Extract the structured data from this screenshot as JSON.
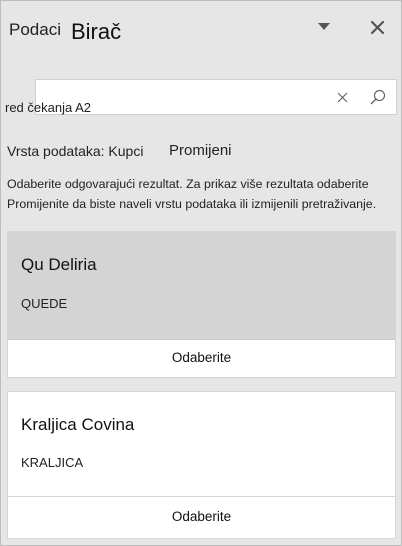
{
  "header": {
    "title_part1": "Podaci",
    "title_part2": "Birač",
    "menu_icon": "chevron-down-icon",
    "close_icon": "close-icon"
  },
  "search": {
    "value": "red čekanja A2",
    "clear_icon": "clear-icon",
    "search_icon": "search-icon"
  },
  "data_type": {
    "label": "Vrsta podataka: Kupci",
    "change_link": "Promijeni"
  },
  "instructions": {
    "line1": "Odaberite odgovarajući rezultat. Za prikaz više rezultata odaberite",
    "line2": "Promijenite da biste naveli vrstu podataka ili izmijenili pretraživanje."
  },
  "results": [
    {
      "name": "Qu Deliria",
      "code": "QUEDE",
      "select_label": "Odaberite",
      "highlighted": true
    },
    {
      "name": "Kraljica Covina",
      "code": "KRALJICA",
      "select_label": "Odaberite",
      "highlighted": false
    }
  ],
  "colors": {
    "pane_bg": "#e6e6e6",
    "highlight_bg": "#d4d4d4",
    "card_bg": "#ffffff"
  }
}
